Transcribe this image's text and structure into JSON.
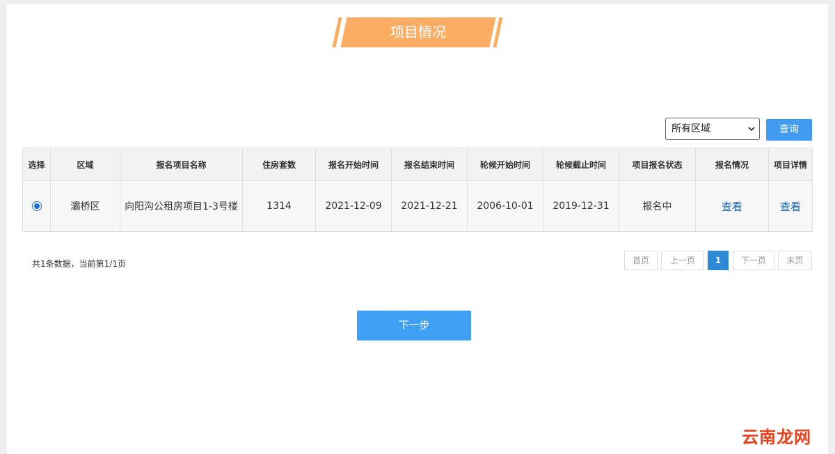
{
  "header": {
    "title": "项目情况"
  },
  "filter": {
    "region_selected": "所有区域",
    "query_label": "查询"
  },
  "table": {
    "columns": [
      "选择",
      "区域",
      "报名项目名称",
      "住房套数",
      "报名开始时间",
      "报名结束时间",
      "轮候开始时间",
      "轮候截止时间",
      "项目报名状态",
      "报名情况",
      "项目详情"
    ],
    "rows": [
      {
        "district": "灞桥区",
        "project_name": "向阳沟公租房项目1-3号楼",
        "housing_count": "1314",
        "signup_start": "2021-12-09",
        "signup_end": "2021-12-21",
        "queue_start": "2006-10-01",
        "queue_end": "2019-12-31",
        "status": "报名中",
        "signup_view": "查看",
        "detail_view": "查看"
      }
    ]
  },
  "pagination": {
    "summary": "共1条数据，当前第1/1页",
    "first": "首页",
    "prev": "上一页",
    "current": "1",
    "next": "下一页",
    "last": "末页"
  },
  "actions": {
    "next_step": "下一步"
  },
  "watermark": "云南龙网",
  "colors": {
    "banner": "#fbae63",
    "primary": "#40a0f4",
    "count_red": "#cc2a2a",
    "link": "#1a63b8"
  }
}
